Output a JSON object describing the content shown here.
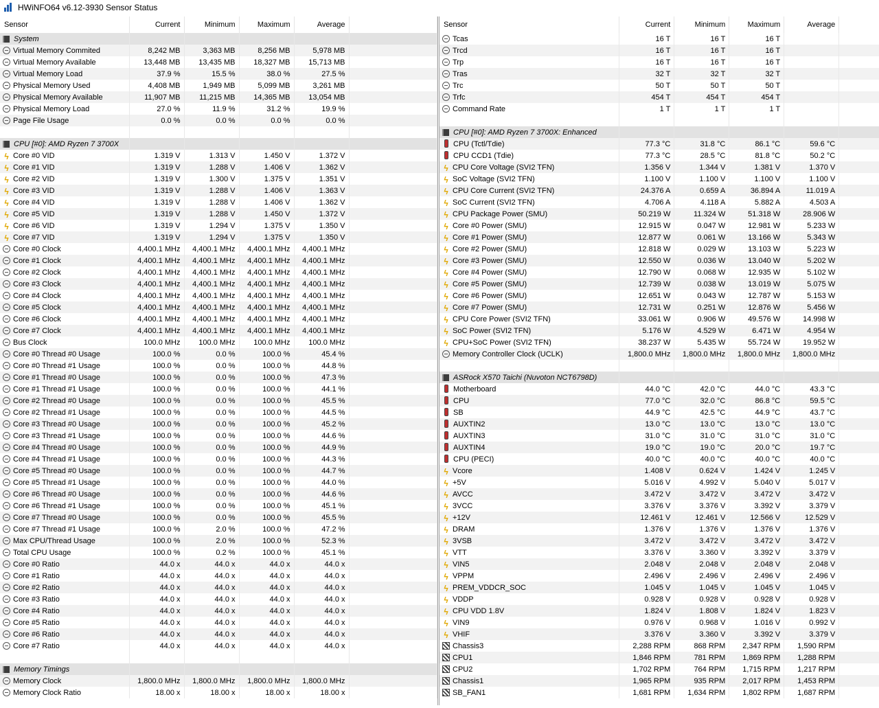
{
  "window": {
    "title": "HWiNFO64 v6.12-3930 Sensor Status"
  },
  "columns": [
    "Sensor",
    "Current",
    "Minimum",
    "Maximum",
    "Average"
  ],
  "left_rows": [
    {
      "type": "group",
      "name": "System"
    },
    {
      "icon": "clock",
      "name": "Virtual Memory Commited",
      "cur": "8,242 MB",
      "min": "3,363 MB",
      "max": "8,256 MB",
      "avg": "5,978 MB"
    },
    {
      "icon": "clock",
      "name": "Virtual Memory Available",
      "cur": "13,448 MB",
      "min": "13,435 MB",
      "max": "18,327 MB",
      "avg": "15,713 MB"
    },
    {
      "icon": "clock",
      "name": "Virtual Memory Load",
      "cur": "37.9 %",
      "min": "15.5 %",
      "max": "38.0 %",
      "avg": "27.5 %"
    },
    {
      "icon": "clock",
      "name": "Physical Memory Used",
      "cur": "4,408 MB",
      "min": "1,949 MB",
      "max": "5,099 MB",
      "avg": "3,261 MB"
    },
    {
      "icon": "clock",
      "name": "Physical Memory Available",
      "cur": "11,907 MB",
      "min": "11,215 MB",
      "max": "14,365 MB",
      "avg": "13,054 MB"
    },
    {
      "icon": "clock",
      "name": "Physical Memory Load",
      "cur": "27.0 %",
      "min": "11.9 %",
      "max": "31.2 %",
      "avg": "19.9 %"
    },
    {
      "icon": "clock",
      "name": "Page File Usage",
      "cur": "0.0 %",
      "min": "0.0 %",
      "max": "0.0 %",
      "avg": "0.0 %"
    },
    {
      "type": "empty"
    },
    {
      "type": "group",
      "name": "CPU [#0]: AMD Ryzen 7 3700X"
    },
    {
      "icon": "volt",
      "name": "Core #0 VID",
      "cur": "1.319 V",
      "min": "1.313 V",
      "max": "1.450 V",
      "avg": "1.372 V"
    },
    {
      "icon": "volt",
      "name": "Core #1 VID",
      "cur": "1.319 V",
      "min": "1.288 V",
      "max": "1.406 V",
      "avg": "1.362 V"
    },
    {
      "icon": "volt",
      "name": "Core #2 VID",
      "cur": "1.319 V",
      "min": "1.300 V",
      "max": "1.375 V",
      "avg": "1.351 V"
    },
    {
      "icon": "volt",
      "name": "Core #3 VID",
      "cur": "1.319 V",
      "min": "1.288 V",
      "max": "1.406 V",
      "avg": "1.363 V"
    },
    {
      "icon": "volt",
      "name": "Core #4 VID",
      "cur": "1.319 V",
      "min": "1.288 V",
      "max": "1.406 V",
      "avg": "1.362 V"
    },
    {
      "icon": "volt",
      "name": "Core #5 VID",
      "cur": "1.319 V",
      "min": "1.288 V",
      "max": "1.450 V",
      "avg": "1.372 V"
    },
    {
      "icon": "volt",
      "name": "Core #6 VID",
      "cur": "1.319 V",
      "min": "1.294 V",
      "max": "1.375 V",
      "avg": "1.350 V"
    },
    {
      "icon": "volt",
      "name": "Core #7 VID",
      "cur": "1.319 V",
      "min": "1.294 V",
      "max": "1.375 V",
      "avg": "1.350 V"
    },
    {
      "icon": "clock",
      "name": "Core #0 Clock",
      "cur": "4,400.1 MHz",
      "min": "4,400.1 MHz",
      "max": "4,400.1 MHz",
      "avg": "4,400.1 MHz"
    },
    {
      "icon": "clock",
      "name": "Core #1 Clock",
      "cur": "4,400.1 MHz",
      "min": "4,400.1 MHz",
      "max": "4,400.1 MHz",
      "avg": "4,400.1 MHz"
    },
    {
      "icon": "clock",
      "name": "Core #2 Clock",
      "cur": "4,400.1 MHz",
      "min": "4,400.1 MHz",
      "max": "4,400.1 MHz",
      "avg": "4,400.1 MHz"
    },
    {
      "icon": "clock",
      "name": "Core #3 Clock",
      "cur": "4,400.1 MHz",
      "min": "4,400.1 MHz",
      "max": "4,400.1 MHz",
      "avg": "4,400.1 MHz"
    },
    {
      "icon": "clock",
      "name": "Core #4 Clock",
      "cur": "4,400.1 MHz",
      "min": "4,400.1 MHz",
      "max": "4,400.1 MHz",
      "avg": "4,400.1 MHz"
    },
    {
      "icon": "clock",
      "name": "Core #5 Clock",
      "cur": "4,400.1 MHz",
      "min": "4,400.1 MHz",
      "max": "4,400.1 MHz",
      "avg": "4,400.1 MHz"
    },
    {
      "icon": "clock",
      "name": "Core #6 Clock",
      "cur": "4,400.1 MHz",
      "min": "4,400.1 MHz",
      "max": "4,400.1 MHz",
      "avg": "4,400.1 MHz"
    },
    {
      "icon": "clock",
      "name": "Core #7 Clock",
      "cur": "4,400.1 MHz",
      "min": "4,400.1 MHz",
      "max": "4,400.1 MHz",
      "avg": "4,400.1 MHz"
    },
    {
      "icon": "clock",
      "name": "Bus Clock",
      "cur": "100.0 MHz",
      "min": "100.0 MHz",
      "max": "100.0 MHz",
      "avg": "100.0 MHz"
    },
    {
      "icon": "clock",
      "name": "Core #0 Thread #0 Usage",
      "cur": "100.0 %",
      "min": "0.0 %",
      "max": "100.0 %",
      "avg": "45.4 %"
    },
    {
      "icon": "clock",
      "name": "Core #0 Thread #1 Usage",
      "cur": "100.0 %",
      "min": "0.0 %",
      "max": "100.0 %",
      "avg": "44.8 %"
    },
    {
      "icon": "clock",
      "name": "Core #1 Thread #0 Usage",
      "cur": "100.0 %",
      "min": "0.0 %",
      "max": "100.0 %",
      "avg": "47.3 %"
    },
    {
      "icon": "clock",
      "name": "Core #1 Thread #1 Usage",
      "cur": "100.0 %",
      "min": "0.0 %",
      "max": "100.0 %",
      "avg": "44.1 %"
    },
    {
      "icon": "clock",
      "name": "Core #2 Thread #0 Usage",
      "cur": "100.0 %",
      "min": "0.0 %",
      "max": "100.0 %",
      "avg": "45.5 %"
    },
    {
      "icon": "clock",
      "name": "Core #2 Thread #1 Usage",
      "cur": "100.0 %",
      "min": "0.0 %",
      "max": "100.0 %",
      "avg": "44.5 %"
    },
    {
      "icon": "clock",
      "name": "Core #3 Thread #0 Usage",
      "cur": "100.0 %",
      "min": "0.0 %",
      "max": "100.0 %",
      "avg": "45.2 %"
    },
    {
      "icon": "clock",
      "name": "Core #3 Thread #1 Usage",
      "cur": "100.0 %",
      "min": "0.0 %",
      "max": "100.0 %",
      "avg": "44.6 %"
    },
    {
      "icon": "clock",
      "name": "Core #4 Thread #0 Usage",
      "cur": "100.0 %",
      "min": "0.0 %",
      "max": "100.0 %",
      "avg": "44.9 %"
    },
    {
      "icon": "clock",
      "name": "Core #4 Thread #1 Usage",
      "cur": "100.0 %",
      "min": "0.0 %",
      "max": "100.0 %",
      "avg": "44.3 %"
    },
    {
      "icon": "clock",
      "name": "Core #5 Thread #0 Usage",
      "cur": "100.0 %",
      "min": "0.0 %",
      "max": "100.0 %",
      "avg": "44.7 %"
    },
    {
      "icon": "clock",
      "name": "Core #5 Thread #1 Usage",
      "cur": "100.0 %",
      "min": "0.0 %",
      "max": "100.0 %",
      "avg": "44.0 %"
    },
    {
      "icon": "clock",
      "name": "Core #6 Thread #0 Usage",
      "cur": "100.0 %",
      "min": "0.0 %",
      "max": "100.0 %",
      "avg": "44.6 %"
    },
    {
      "icon": "clock",
      "name": "Core #6 Thread #1 Usage",
      "cur": "100.0 %",
      "min": "0.0 %",
      "max": "100.0 %",
      "avg": "45.1 %"
    },
    {
      "icon": "clock",
      "name": "Core #7 Thread #0 Usage",
      "cur": "100.0 %",
      "min": "0.0 %",
      "max": "100.0 %",
      "avg": "45.5 %"
    },
    {
      "icon": "clock",
      "name": "Core #7 Thread #1 Usage",
      "cur": "100.0 %",
      "min": "2.0 %",
      "max": "100.0 %",
      "avg": "47.2 %"
    },
    {
      "icon": "clock",
      "name": "Max CPU/Thread Usage",
      "cur": "100.0 %",
      "min": "2.0 %",
      "max": "100.0 %",
      "avg": "52.3 %"
    },
    {
      "icon": "clock",
      "name": "Total CPU Usage",
      "cur": "100.0 %",
      "min": "0.2 %",
      "max": "100.0 %",
      "avg": "45.1 %"
    },
    {
      "icon": "clock",
      "name": "Core #0 Ratio",
      "cur": "44.0 x",
      "min": "44.0 x",
      "max": "44.0 x",
      "avg": "44.0 x"
    },
    {
      "icon": "clock",
      "name": "Core #1 Ratio",
      "cur": "44.0 x",
      "min": "44.0 x",
      "max": "44.0 x",
      "avg": "44.0 x"
    },
    {
      "icon": "clock",
      "name": "Core #2 Ratio",
      "cur": "44.0 x",
      "min": "44.0 x",
      "max": "44.0 x",
      "avg": "44.0 x"
    },
    {
      "icon": "clock",
      "name": "Core #3 Ratio",
      "cur": "44.0 x",
      "min": "44.0 x",
      "max": "44.0 x",
      "avg": "44.0 x"
    },
    {
      "icon": "clock",
      "name": "Core #4 Ratio",
      "cur": "44.0 x",
      "min": "44.0 x",
      "max": "44.0 x",
      "avg": "44.0 x"
    },
    {
      "icon": "clock",
      "name": "Core #5 Ratio",
      "cur": "44.0 x",
      "min": "44.0 x",
      "max": "44.0 x",
      "avg": "44.0 x"
    },
    {
      "icon": "clock",
      "name": "Core #6 Ratio",
      "cur": "44.0 x",
      "min": "44.0 x",
      "max": "44.0 x",
      "avg": "44.0 x"
    },
    {
      "icon": "clock",
      "name": "Core #7 Ratio",
      "cur": "44.0 x",
      "min": "44.0 x",
      "max": "44.0 x",
      "avg": "44.0 x"
    },
    {
      "type": "empty"
    },
    {
      "type": "group",
      "name": "Memory Timings"
    },
    {
      "icon": "clock",
      "name": "Memory Clock",
      "cur": "1,800.0 MHz",
      "min": "1,800.0 MHz",
      "max": "1,800.0 MHz",
      "avg": "1,800.0 MHz"
    },
    {
      "icon": "clock",
      "name": "Memory Clock Ratio",
      "cur": "18.00 x",
      "min": "18.00 x",
      "max": "18.00 x",
      "avg": "18.00 x"
    }
  ],
  "right_rows": [
    {
      "icon": "clock",
      "name": "Tcas",
      "cur": "16 T",
      "min": "16 T",
      "max": "16 T",
      "avg": ""
    },
    {
      "icon": "clock",
      "name": "Trcd",
      "cur": "16 T",
      "min": "16 T",
      "max": "16 T",
      "avg": ""
    },
    {
      "icon": "clock",
      "name": "Trp",
      "cur": "16 T",
      "min": "16 T",
      "max": "16 T",
      "avg": ""
    },
    {
      "icon": "clock",
      "name": "Tras",
      "cur": "32 T",
      "min": "32 T",
      "max": "32 T",
      "avg": ""
    },
    {
      "icon": "clock",
      "name": "Trc",
      "cur": "50 T",
      "min": "50 T",
      "max": "50 T",
      "avg": ""
    },
    {
      "icon": "clock",
      "name": "Trfc",
      "cur": "454 T",
      "min": "454 T",
      "max": "454 T",
      "avg": ""
    },
    {
      "icon": "clock",
      "name": "Command Rate",
      "cur": "1 T",
      "min": "1 T",
      "max": "1 T",
      "avg": ""
    },
    {
      "type": "empty"
    },
    {
      "type": "group",
      "name": "CPU [#0]: AMD Ryzen 7 3700X: Enhanced"
    },
    {
      "icon": "temp",
      "name": "CPU (Tctl/Tdie)",
      "cur": "77.3 °C",
      "min": "31.8 °C",
      "max": "86.1 °C",
      "avg": "59.6 °C"
    },
    {
      "icon": "temp",
      "name": "CPU CCD1 (Tdie)",
      "cur": "77.3 °C",
      "min": "28.5 °C",
      "max": "81.8 °C",
      "avg": "50.2 °C"
    },
    {
      "icon": "volt",
      "name": "CPU Core Voltage (SVI2 TFN)",
      "cur": "1.356 V",
      "min": "1.344 V",
      "max": "1.381 V",
      "avg": "1.370 V"
    },
    {
      "icon": "volt",
      "name": "SoC Voltage (SVI2 TFN)",
      "cur": "1.100 V",
      "min": "1.100 V",
      "max": "1.100 V",
      "avg": "1.100 V"
    },
    {
      "icon": "volt",
      "name": "CPU Core Current (SVI2 TFN)",
      "cur": "24.376 A",
      "min": "0.659 A",
      "max": "36.894 A",
      "avg": "11.019 A"
    },
    {
      "icon": "volt",
      "name": "SoC Current (SVI2 TFN)",
      "cur": "4.706 A",
      "min": "4.118 A",
      "max": "5.882 A",
      "avg": "4.503 A"
    },
    {
      "icon": "volt",
      "name": "CPU Package Power (SMU)",
      "cur": "50.219 W",
      "min": "11.324 W",
      "max": "51.318 W",
      "avg": "28.906 W"
    },
    {
      "icon": "volt",
      "name": "Core #0 Power (SMU)",
      "cur": "12.915 W",
      "min": "0.047 W",
      "max": "12.981 W",
      "avg": "5.233 W"
    },
    {
      "icon": "volt",
      "name": "Core #1 Power (SMU)",
      "cur": "12.877 W",
      "min": "0.061 W",
      "max": "13.166 W",
      "avg": "5.343 W"
    },
    {
      "icon": "volt",
      "name": "Core #2 Power (SMU)",
      "cur": "12.818 W",
      "min": "0.029 W",
      "max": "13.103 W",
      "avg": "5.223 W"
    },
    {
      "icon": "volt",
      "name": "Core #3 Power (SMU)",
      "cur": "12.550 W",
      "min": "0.036 W",
      "max": "13.040 W",
      "avg": "5.202 W"
    },
    {
      "icon": "volt",
      "name": "Core #4 Power (SMU)",
      "cur": "12.790 W",
      "min": "0.068 W",
      "max": "12.935 W",
      "avg": "5.102 W"
    },
    {
      "icon": "volt",
      "name": "Core #5 Power (SMU)",
      "cur": "12.739 W",
      "min": "0.038 W",
      "max": "13.019 W",
      "avg": "5.075 W"
    },
    {
      "icon": "volt",
      "name": "Core #6 Power (SMU)",
      "cur": "12.651 W",
      "min": "0.043 W",
      "max": "12.787 W",
      "avg": "5.153 W"
    },
    {
      "icon": "volt",
      "name": "Core #7 Power (SMU)",
      "cur": "12.731 W",
      "min": "0.251 W",
      "max": "12.876 W",
      "avg": "5.456 W"
    },
    {
      "icon": "volt",
      "name": "CPU Core Power (SVI2 TFN)",
      "cur": "33.061 W",
      "min": "0.906 W",
      "max": "49.576 W",
      "avg": "14.998 W"
    },
    {
      "icon": "volt",
      "name": "SoC Power (SVI2 TFN)",
      "cur": "5.176 W",
      "min": "4.529 W",
      "max": "6.471 W",
      "avg": "4.954 W"
    },
    {
      "icon": "volt",
      "name": "CPU+SoC Power (SVI2 TFN)",
      "cur": "38.237 W",
      "min": "5.435 W",
      "max": "55.724 W",
      "avg": "19.952 W"
    },
    {
      "icon": "clock",
      "name": "Memory Controller Clock (UCLK)",
      "cur": "1,800.0 MHz",
      "min": "1,800.0 MHz",
      "max": "1,800.0 MHz",
      "avg": "1,800.0 MHz"
    },
    {
      "type": "empty"
    },
    {
      "type": "group",
      "name": "ASRock X570 Taichi (Nuvoton NCT6798D)"
    },
    {
      "icon": "temp",
      "name": "Motherboard",
      "cur": "44.0 °C",
      "min": "42.0 °C",
      "max": "44.0 °C",
      "avg": "43.3 °C"
    },
    {
      "icon": "temp",
      "name": "CPU",
      "cur": "77.0 °C",
      "min": "32.0 °C",
      "max": "86.8 °C",
      "avg": "59.5 °C"
    },
    {
      "icon": "temp",
      "name": "SB",
      "cur": "44.9 °C",
      "min": "42.5 °C",
      "max": "44.9 °C",
      "avg": "43.7 °C"
    },
    {
      "icon": "temp",
      "name": "AUXTIN2",
      "cur": "13.0 °C",
      "min": "13.0 °C",
      "max": "13.0 °C",
      "avg": "13.0 °C"
    },
    {
      "icon": "temp",
      "name": "AUXTIN3",
      "cur": "31.0 °C",
      "min": "31.0 °C",
      "max": "31.0 °C",
      "avg": "31.0 °C"
    },
    {
      "icon": "temp",
      "name": "AUXTIN4",
      "cur": "19.0 °C",
      "min": "19.0 °C",
      "max": "20.0 °C",
      "avg": "19.7 °C"
    },
    {
      "icon": "temp",
      "name": "CPU (PECI)",
      "cur": "40.0 °C",
      "min": "40.0 °C",
      "max": "40.0 °C",
      "avg": "40.0 °C"
    },
    {
      "icon": "volt",
      "name": "Vcore",
      "cur": "1.408 V",
      "min": "0.624 V",
      "max": "1.424 V",
      "avg": "1.245 V"
    },
    {
      "icon": "volt",
      "name": "+5V",
      "cur": "5.016 V",
      "min": "4.992 V",
      "max": "5.040 V",
      "avg": "5.017 V"
    },
    {
      "icon": "volt",
      "name": "AVCC",
      "cur": "3.472 V",
      "min": "3.472 V",
      "max": "3.472 V",
      "avg": "3.472 V"
    },
    {
      "icon": "volt",
      "name": "3VCC",
      "cur": "3.376 V",
      "min": "3.376 V",
      "max": "3.392 V",
      "avg": "3.379 V"
    },
    {
      "icon": "volt",
      "name": "+12V",
      "cur": "12.461 V",
      "min": "12.461 V",
      "max": "12.566 V",
      "avg": "12.529 V"
    },
    {
      "icon": "volt",
      "name": "DRAM",
      "cur": "1.376 V",
      "min": "1.376 V",
      "max": "1.376 V",
      "avg": "1.376 V"
    },
    {
      "icon": "volt",
      "name": "3VSB",
      "cur": "3.472 V",
      "min": "3.472 V",
      "max": "3.472 V",
      "avg": "3.472 V"
    },
    {
      "icon": "volt",
      "name": "VTT",
      "cur": "3.376 V",
      "min": "3.360 V",
      "max": "3.392 V",
      "avg": "3.379 V"
    },
    {
      "icon": "volt",
      "name": "VIN5",
      "cur": "2.048 V",
      "min": "2.048 V",
      "max": "2.048 V",
      "avg": "2.048 V"
    },
    {
      "icon": "volt",
      "name": "VPPM",
      "cur": "2.496 V",
      "min": "2.496 V",
      "max": "2.496 V",
      "avg": "2.496 V"
    },
    {
      "icon": "volt",
      "name": "PREM_VDDCR_SOC",
      "cur": "1.045 V",
      "min": "1.045 V",
      "max": "1.045 V",
      "avg": "1.045 V"
    },
    {
      "icon": "volt",
      "name": "VDDP",
      "cur": "0.928 V",
      "min": "0.928 V",
      "max": "0.928 V",
      "avg": "0.928 V"
    },
    {
      "icon": "volt",
      "name": "CPU VDD 1.8V",
      "cur": "1.824 V",
      "min": "1.808 V",
      "max": "1.824 V",
      "avg": "1.823 V"
    },
    {
      "icon": "volt",
      "name": "VIN9",
      "cur": "0.976 V",
      "min": "0.968 V",
      "max": "1.016 V",
      "avg": "0.992 V"
    },
    {
      "icon": "volt",
      "name": "VHIF",
      "cur": "3.376 V",
      "min": "3.360 V",
      "max": "3.392 V",
      "avg": "3.379 V"
    },
    {
      "icon": "fan",
      "name": "Chassis3",
      "cur": "2,288 RPM",
      "min": "868 RPM",
      "max": "2,347 RPM",
      "avg": "1,590 RPM"
    },
    {
      "icon": "fan",
      "name": "CPU1",
      "cur": "1,846 RPM",
      "min": "781 RPM",
      "max": "1,869 RPM",
      "avg": "1,288 RPM"
    },
    {
      "icon": "fan",
      "name": "CPU2",
      "cur": "1,702 RPM",
      "min": "764 RPM",
      "max": "1,715 RPM",
      "avg": "1,217 RPM"
    },
    {
      "icon": "fan",
      "name": "Chassis1",
      "cur": "1,965 RPM",
      "min": "935 RPM",
      "max": "2,017 RPM",
      "avg": "1,453 RPM"
    },
    {
      "icon": "fan",
      "name": "SB_FAN1",
      "cur": "1,681 RPM",
      "min": "1,634 RPM",
      "max": "1,802 RPM",
      "avg": "1,687 RPM"
    }
  ]
}
